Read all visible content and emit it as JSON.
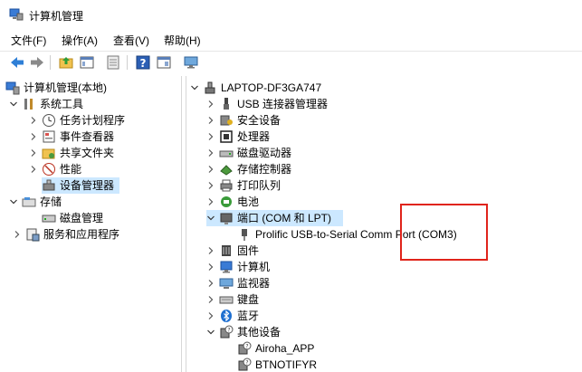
{
  "window": {
    "title": "计算机管理"
  },
  "menu": {
    "file": "文件(F)",
    "action": "操作(A)",
    "view": "查看(V)",
    "help": "帮助(H)"
  },
  "toolbar": {
    "icons": [
      "back-arrow-icon",
      "forward-arrow-icon",
      "up-folder-icon",
      "console-tree-icon",
      "properties-icon",
      "help-icon",
      "show-hide-icon",
      "monitor-icon"
    ]
  },
  "left_tree": {
    "root": "计算机管理(本地)",
    "system_tools": "系统工具",
    "task_scheduler": "任务计划程序",
    "event_viewer": "事件查看器",
    "shared_folders": "共享文件夹",
    "performance": "性能",
    "device_manager": "设备管理器",
    "storage": "存储",
    "disk_management": "磁盘管理",
    "services_apps": "服务和应用程序"
  },
  "right_tree": {
    "computer": "LAPTOP-DF3GA747",
    "usb_controllers": "USB 连接器管理器",
    "security_devices": "安全设备",
    "processors": "处理器",
    "disk_drives": "磁盘驱动器",
    "storage_controllers": "存储控制器",
    "print_queues": "打印队列",
    "battery": "电池",
    "ports": "端口 (COM 和 LPT)",
    "prolific_port": "Prolific USB-to-Serial Comm Port (COM3)",
    "firmware": "固件",
    "computer_node": "计算机",
    "monitors": "监视器",
    "keyboards": "键盘",
    "bluetooth": "蓝牙",
    "other_devices": "其他设备",
    "airoha": "Airoha_APP",
    "btnotifyr": "BTNOTIFYR"
  },
  "colors": {
    "selection": "#cce8ff",
    "highlight_box": "#e0241b"
  }
}
